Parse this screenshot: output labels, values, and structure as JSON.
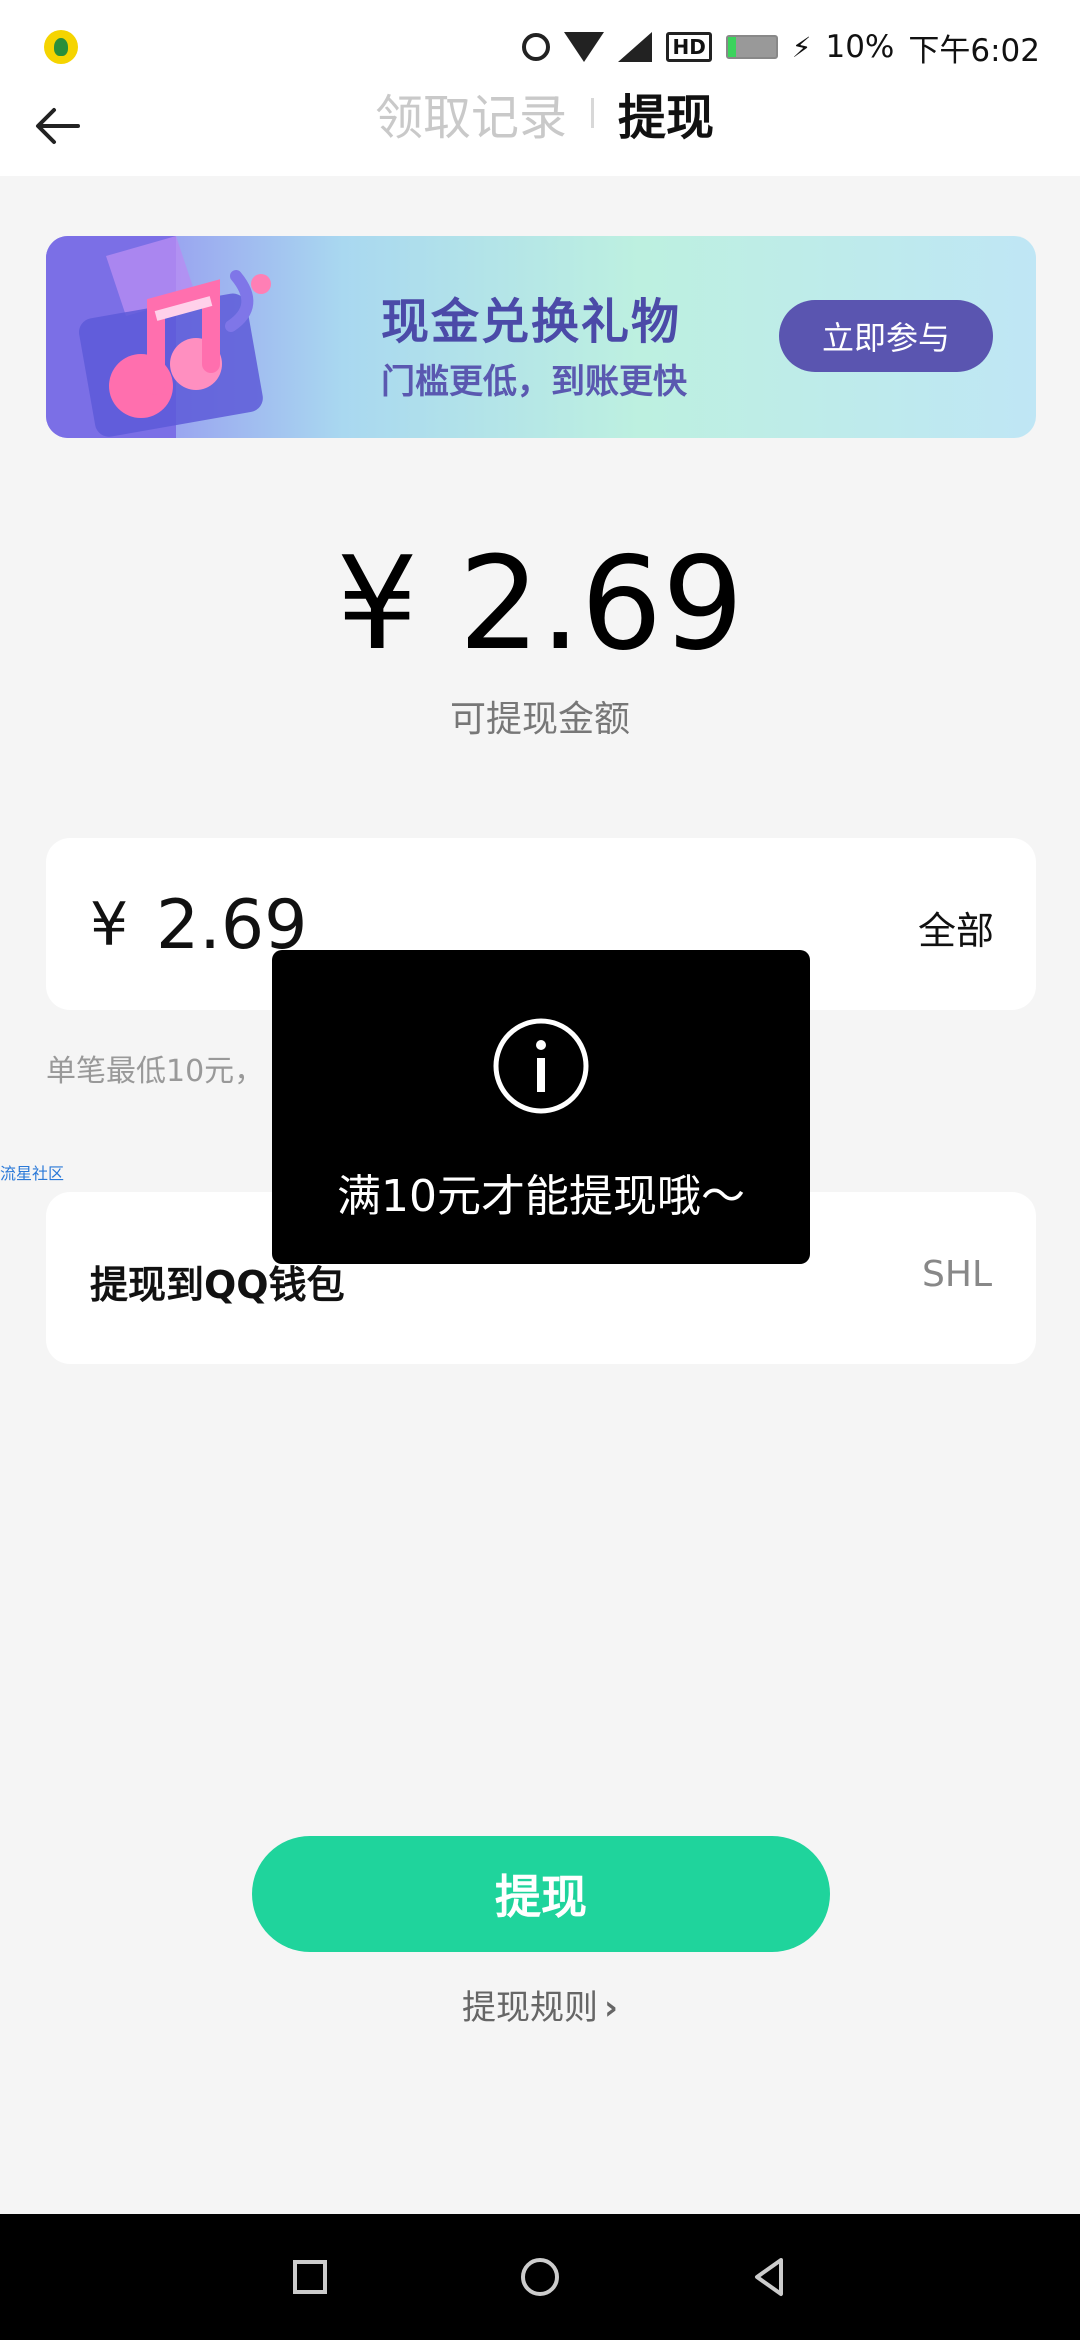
{
  "status_bar": {
    "app_icon": "qq-music-icon",
    "battery_text": "10%",
    "time": "下午6:02",
    "hd_badge": "HD",
    "icons": [
      "alarm-icon",
      "wifi-icon",
      "signal-icon",
      "hd-icon",
      "battery-icon",
      "charging-icon"
    ]
  },
  "header": {
    "back_icon": "back-arrow-icon",
    "tabs": [
      {
        "label": "领取记录",
        "active": false
      },
      {
        "label": "提现",
        "active": true
      }
    ]
  },
  "banner": {
    "title": "现金兑换礼物",
    "subtitle": "门槛更低，到账更快",
    "button_label": "立即参与",
    "art_icon": "music-note-icon"
  },
  "balance": {
    "amount": "¥ 2.69",
    "label": "可提现金额"
  },
  "withdraw_input": {
    "currency": "¥",
    "value": "2.69",
    "all_label": "全部"
  },
  "hint_text": "单笔最低10元，",
  "side_link": "流星社区",
  "wallet": {
    "label": "提现到QQ钱包",
    "account": "SHL"
  },
  "toast": {
    "icon": "info-icon",
    "message": "满10元才能提现哦～"
  },
  "withdraw_button": "提现",
  "rules_link": "提现规则",
  "nav_bar": {
    "icons": [
      "recent-apps-icon",
      "home-icon",
      "back-icon"
    ]
  },
  "colors": {
    "accent": "#1fd49c",
    "banner_button": "#5a55b0",
    "toast_bg": "#000000"
  }
}
